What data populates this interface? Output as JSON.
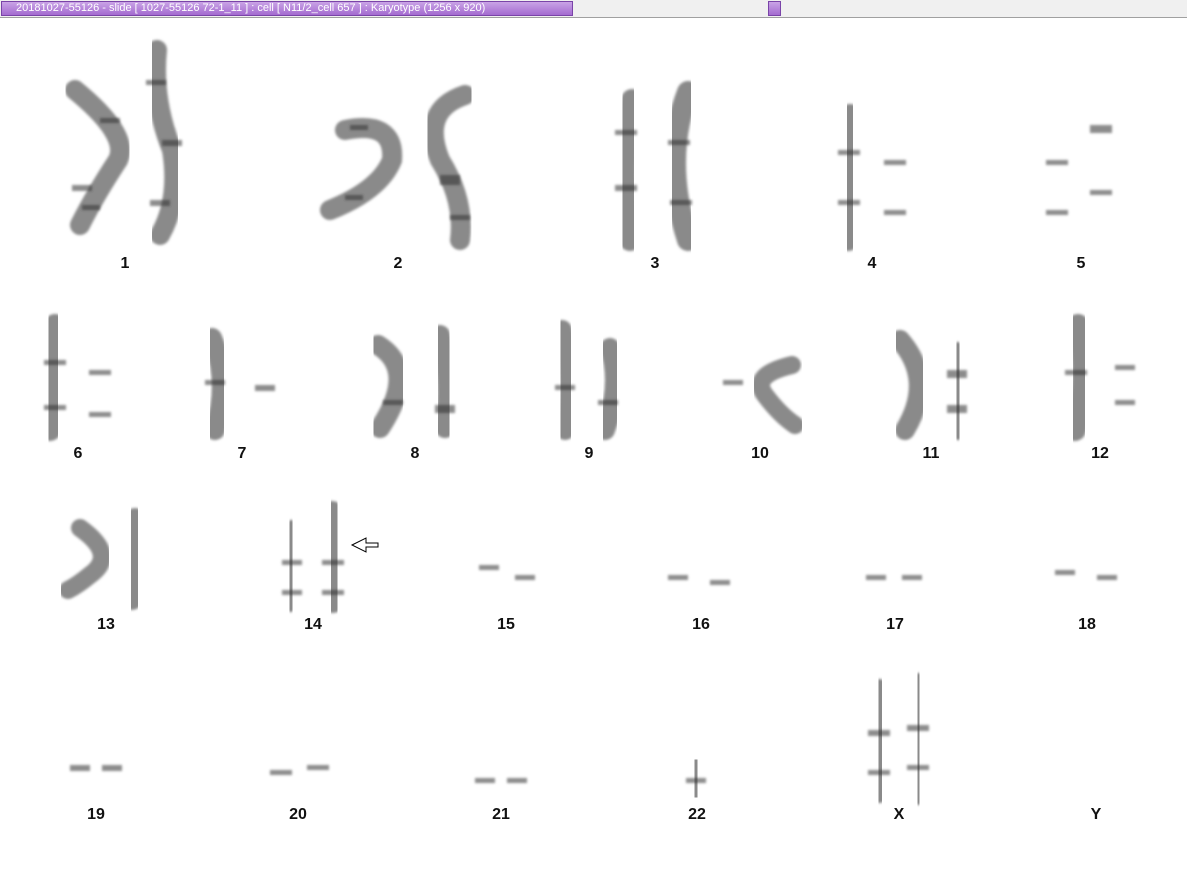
{
  "window": {
    "title": "20181027-55126 - slide [ 1027-55126 72-1_11 ] : cell [ N11/2_cell 657 ] : Karyotype  (1256 x 920)"
  },
  "karyotype": {
    "labels": [
      "1",
      "2",
      "3",
      "4",
      "5",
      "6",
      "7",
      "8",
      "9",
      "10",
      "11",
      "12",
      "13",
      "14",
      "15",
      "16",
      "17",
      "18",
      "19",
      "20",
      "21",
      "22",
      "X",
      "Y"
    ],
    "annotation_arrow_on": "14",
    "colors": {
      "chromosome": "#7f7f7f",
      "band": "#2e2e2e",
      "label": "#111111",
      "title_bar": "#a46bd0"
    }
  }
}
